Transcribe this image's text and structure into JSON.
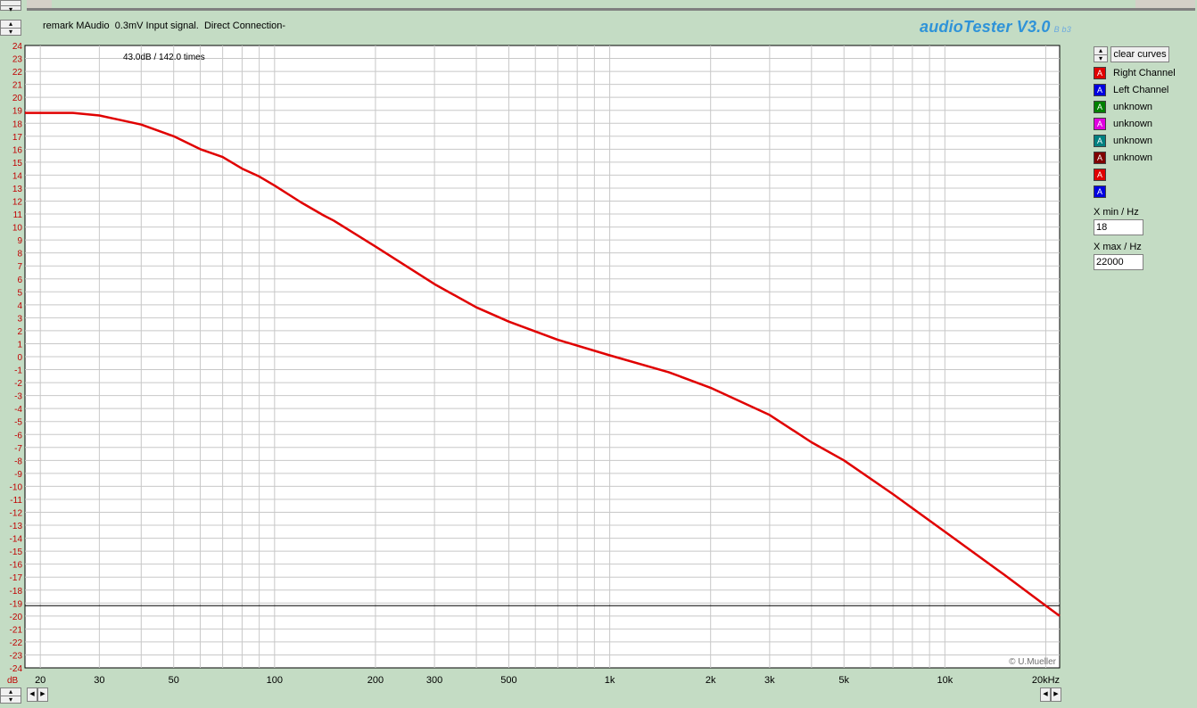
{
  "app": {
    "remark": "remark MAudio  0.3mV Input signal.  Direct Connection-",
    "brand": "audioTester V3.0",
    "brand_version": "B b3",
    "gain_annotation": "43.0dB / 142.0 times",
    "copyright": "© U.Mueller"
  },
  "controls": {
    "clear_curves": "clear curves",
    "xmin_label": "X min / Hz",
    "xmin_value": "18",
    "xmax_label": "X max / Hz",
    "xmax_value": "22000"
  },
  "legend": [
    {
      "label": "Right Channel",
      "color": "#e00000"
    },
    {
      "label": "Left Channel",
      "color": "#0000e0"
    },
    {
      "label": "unknown",
      "color": "#008000"
    },
    {
      "label": "unknown",
      "color": "#e000e0"
    },
    {
      "label": "unknown",
      "color": "#008080"
    },
    {
      "label": "unknown",
      "color": "#800000"
    },
    {
      "label": "",
      "color": "#e00000"
    },
    {
      "label": "",
      "color": "#0000e0"
    }
  ],
  "chart_data": {
    "type": "line",
    "xscale": "log",
    "xlim": [
      18,
      22000
    ],
    "ylim": [
      -24,
      24
    ],
    "ylabel": "dB",
    "xtick_labels": [
      {
        "v": 20,
        "t": "20"
      },
      {
        "v": 30,
        "t": "30"
      },
      {
        "v": 50,
        "t": "50"
      },
      {
        "v": 100,
        "t": "100"
      },
      {
        "v": 200,
        "t": "200"
      },
      {
        "v": 300,
        "t": "300"
      },
      {
        "v": 500,
        "t": "500"
      },
      {
        "v": 1000,
        "t": "1k"
      },
      {
        "v": 2000,
        "t": "2k"
      },
      {
        "v": 3000,
        "t": "3k"
      },
      {
        "v": 5000,
        "t": "5k"
      },
      {
        "v": 10000,
        "t": "10k"
      },
      {
        "v": 20000,
        "t": "20kHz"
      }
    ],
    "reference_line_db": -19.2,
    "grid": true,
    "series": [
      {
        "name": "Right Channel",
        "color": "#e00000",
        "x": [
          18,
          25,
          30,
          40,
          50,
          60,
          70,
          80,
          90,
          100,
          120,
          140,
          150,
          200,
          300,
          400,
          500,
          700,
          1000,
          1500,
          2000,
          3000,
          4000,
          5000,
          7000,
          10000,
          15000,
          20000,
          22000
        ],
        "y": [
          18.8,
          18.8,
          18.6,
          17.9,
          17.0,
          16.0,
          15.4,
          14.5,
          13.9,
          13.2,
          11.9,
          10.9,
          10.5,
          8.5,
          5.6,
          3.8,
          2.7,
          1.3,
          0.1,
          -1.2,
          -2.4,
          -4.5,
          -6.6,
          -8.0,
          -10.6,
          -13.5,
          -16.8,
          -19.2,
          -20.0
        ]
      }
    ]
  }
}
